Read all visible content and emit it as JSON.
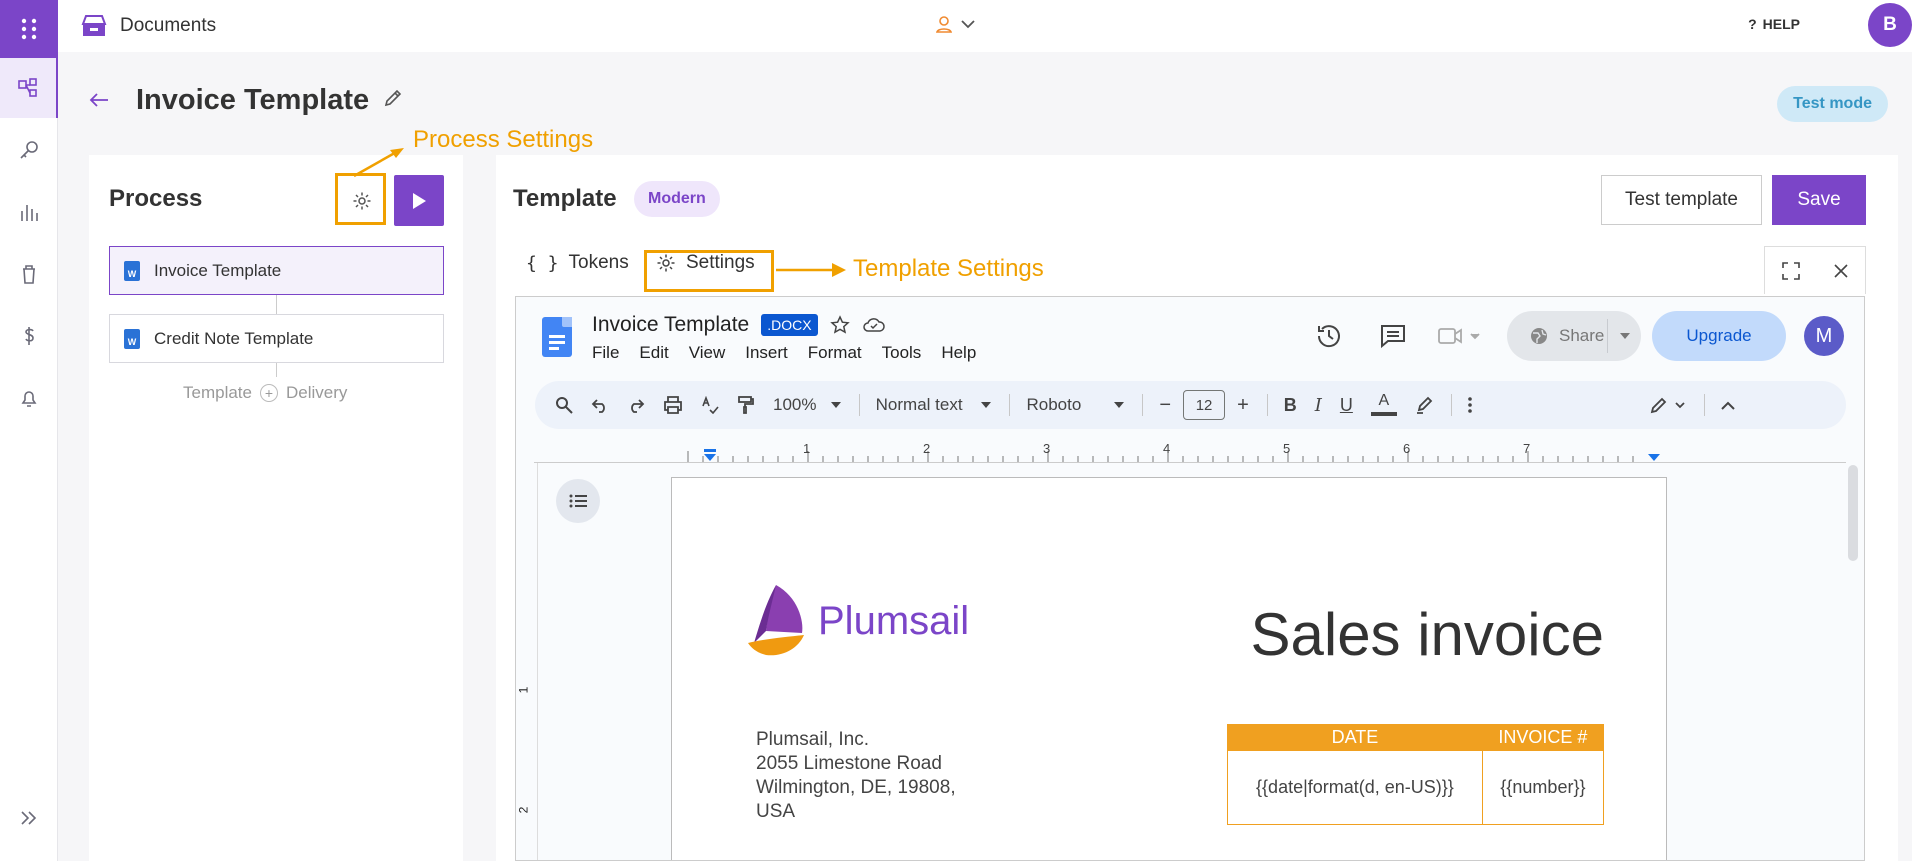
{
  "app": {
    "title": "Documents"
  },
  "header": {
    "help_label": "HELP",
    "user_initial": "B"
  },
  "page": {
    "title": "Invoice Template",
    "badge": "Test mode"
  },
  "annotations": {
    "process_settings": "Process Settings",
    "template_settings": "Template Settings"
  },
  "process": {
    "title": "Process",
    "items": [
      {
        "label": "Invoice Template"
      },
      {
        "label": "Credit Note Template"
      }
    ],
    "flow": {
      "left": "Template",
      "right": "Delivery"
    }
  },
  "template": {
    "title": "Template",
    "style_badge": "Modern",
    "test_button": "Test template",
    "save_button": "Save",
    "tabs": [
      {
        "label": "Tokens"
      },
      {
        "label": "Settings"
      }
    ]
  },
  "gdocs": {
    "title": "Invoice Template",
    "badge": ".DOCX",
    "menu": [
      "File",
      "Edit",
      "View",
      "Insert",
      "Format",
      "Tools",
      "Help"
    ],
    "share_label": "Share",
    "upgrade_label": "Upgrade",
    "avatar": "M",
    "toolbar": {
      "zoom": "100%",
      "style": "Normal text",
      "font": "Roboto",
      "font_size": "12"
    },
    "ruler": [
      "1",
      "2",
      "3",
      "4",
      "5",
      "6",
      "7"
    ],
    "vruler": [
      "1",
      "2"
    ]
  },
  "document": {
    "logo_text": "Plumsail",
    "heading": "Sales invoice",
    "address": [
      "Plumsail, Inc.",
      "2055 Limestone Road",
      "Wilmington, DE, 19808,",
      "USA"
    ],
    "table": {
      "headers": [
        "DATE",
        "INVOICE #"
      ],
      "cells": [
        "{{date|format(d, en-US)}}",
        "{{number}}"
      ]
    }
  },
  "colors": {
    "accent": "#7b45c8",
    "annotation": "#f0a000",
    "docs_blue": "#0b57d0"
  }
}
